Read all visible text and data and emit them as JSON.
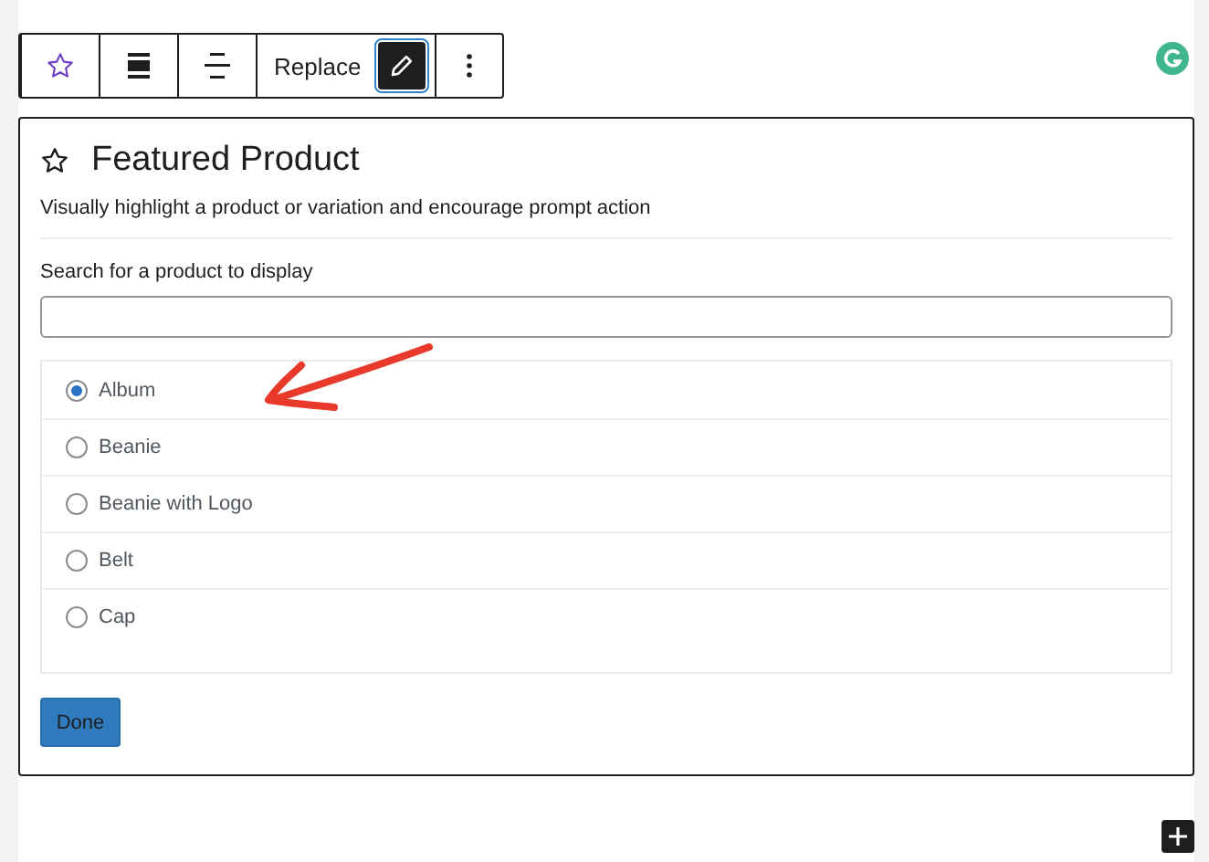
{
  "toolbar": [
    {
      "kind": "star",
      "selected": false
    },
    {
      "kind": "wide",
      "selected": false
    },
    {
      "kind": "center",
      "selected": false
    },
    {
      "kind": "text",
      "label": "Replace",
      "selected": false
    },
    {
      "kind": "pencil",
      "selected": true
    },
    {
      "kind": "more",
      "selected": false
    }
  ],
  "block": {
    "title": "Featured Product",
    "description": "Visually highlight a product or variation and encourage prompt action",
    "search_label": "Search for a product to display",
    "options": [
      {
        "label": "Album",
        "selected": true
      },
      {
        "label": "Beanie",
        "selected": false
      },
      {
        "label": "Beanie with Logo",
        "selected": false
      },
      {
        "label": "Belt",
        "selected": false
      },
      {
        "label": "Cap",
        "selected": false
      }
    ],
    "done_button": "Done"
  }
}
